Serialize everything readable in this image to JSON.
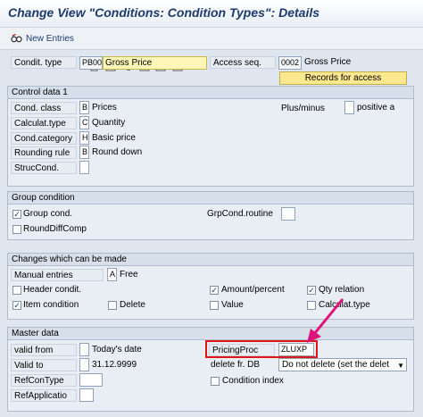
{
  "title": "Change View \"Conditions: Condition Types\": Details",
  "toolbar": {
    "new_entries": "New Entries"
  },
  "header": {
    "condit_type_label": "Condit. type",
    "condit_type_code": "PB00",
    "condit_type_name": "Gross Price",
    "access_seq_label": "Access seq.",
    "access_seq_code": "0002",
    "access_seq_name": "Gross Price",
    "records_button": "Records for access"
  },
  "control_data": {
    "title": "Control data 1",
    "cond_class_label": "Cond. class",
    "cond_class_value": "B",
    "cond_class_text": "Prices",
    "calculat_type_label": "Calculat.type",
    "calculat_type_value": "C",
    "calculat_type_text": "Quantity",
    "cond_category_label": "Cond.category",
    "cond_category_value": "H",
    "cond_category_text": "Basic price",
    "rounding_rule_label": "Rounding rule",
    "rounding_rule_value": "B",
    "rounding_rule_text": "Round down",
    "struc_cond_label": "StrucCond.",
    "plus_minus_label": "Plus/minus",
    "plus_minus_text": "positive a"
  },
  "group_condition": {
    "title": "Group condition",
    "group_cond_label": "Group cond.",
    "group_cond_checked": true,
    "grp_routine_label": "GrpCond.routine",
    "round_diff_label": "RoundDiffComp"
  },
  "changes": {
    "title": "Changes which can be made",
    "manual_entries_label": "Manual entries",
    "manual_entries_value": "A",
    "manual_entries_text": "Free",
    "header_condit_label": "Header condit.",
    "item_condition_label": "Item condition",
    "delete_label": "Delete",
    "amount_percent_label": "Amount/percent",
    "value_label": "Value",
    "qty_relation_label": "Qty relation",
    "calculat_type_label": "Calculat.type"
  },
  "master_data": {
    "title": "Master data",
    "valid_from_label": "valid from",
    "valid_from_text": "Today's date",
    "valid_to_label": "Valid to",
    "valid_to_value": "31.12.9999",
    "ref_con_type_label": "RefConType",
    "ref_applicatio_label": "RefApplicatio",
    "pricing_proc_label": "PricingProc",
    "pricing_proc_value": "ZLUXP",
    "delete_fr_db_label": "delete fr. DB",
    "delete_fr_db_value": "Do not delete (set the delet",
    "condition_index_label": "Condition index"
  },
  "colors": {
    "highlight_box": "#e01616",
    "arrow": "#e0137a",
    "button_yellow": "#fce88f"
  }
}
